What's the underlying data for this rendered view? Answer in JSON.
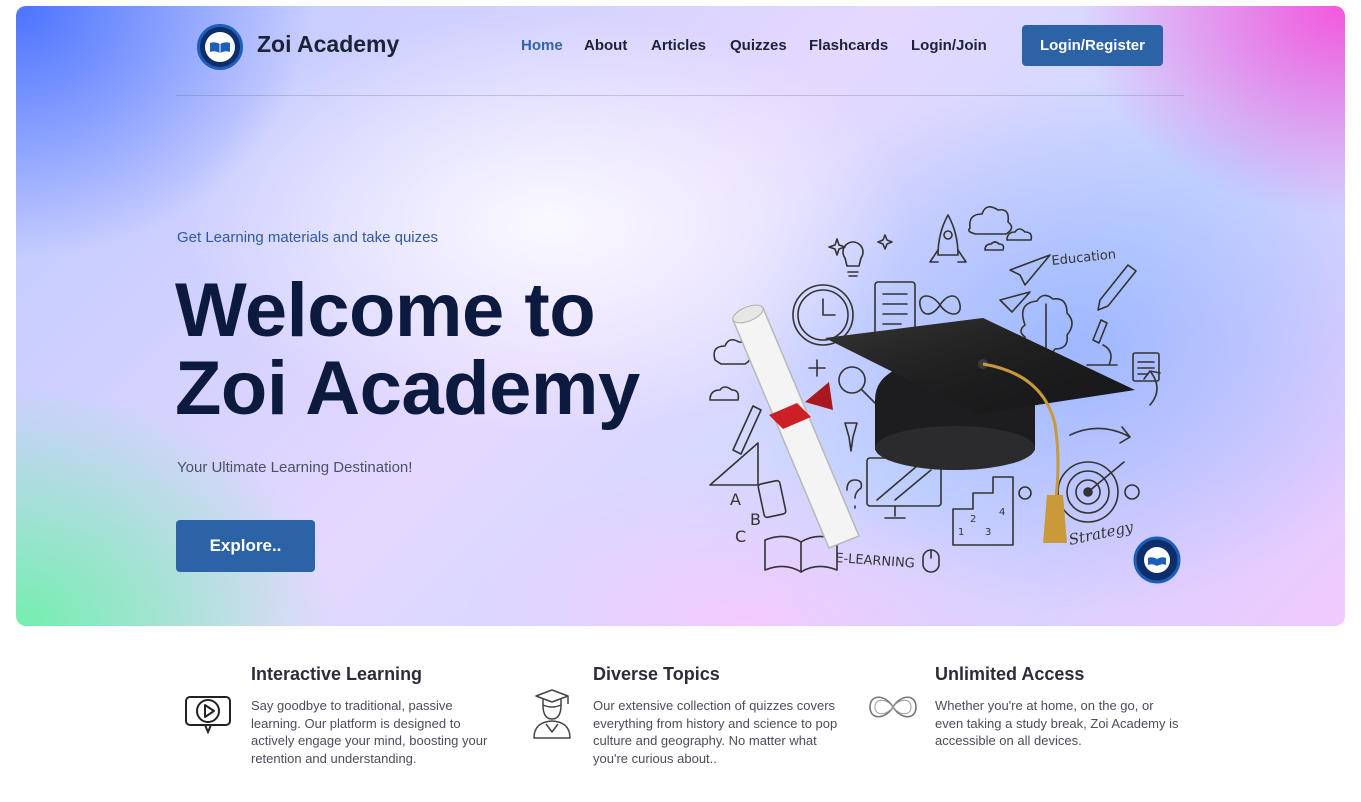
{
  "header": {
    "brand": "Zoi Academy",
    "logo_icon": "zoi-academy-seal-logo",
    "nav": [
      {
        "label": "Home",
        "active": true
      },
      {
        "label": "About",
        "active": false
      },
      {
        "label": "Articles",
        "active": false
      },
      {
        "label": "Quizzes",
        "active": false
      },
      {
        "label": "Flashcards",
        "active": false
      },
      {
        "label": "Login/Join",
        "active": false
      }
    ],
    "cta_label": "Login/Register"
  },
  "hero": {
    "tagline": "Get Learning materials and take quizes",
    "headline_line1": "Welcome to",
    "headline_line2": "Zoi Academy",
    "subtitle": "Your Ultimate Learning Destination!",
    "button_label": "Explore..",
    "illustration": {
      "icon": "graduation-cap-doodle-illustration",
      "doodle_texts": [
        "Education",
        "E-LEARNING",
        "Strategy"
      ]
    }
  },
  "features": [
    {
      "icon": "interactive-video-icon",
      "title": "Interactive Learning",
      "text": "Say goodbye to traditional, passive learning. Our platform is designed to actively engage your mind, boosting your retention and understanding."
    },
    {
      "icon": "graduate-student-icon",
      "title": "Diverse Topics",
      "text": "Our extensive collection of quizzes covers everything from history and science to pop culture and geography. No matter what you're curious about.."
    },
    {
      "icon": "infinity-icon",
      "title": "Unlimited Access",
      "text": "Whether you're at home, on the go, or even taking a study break, Zoi Academy is accessible on all devices."
    }
  ],
  "colors": {
    "primary": "#2c63a7",
    "heading": "#0c1a40",
    "nav_active": "#3264a8"
  }
}
